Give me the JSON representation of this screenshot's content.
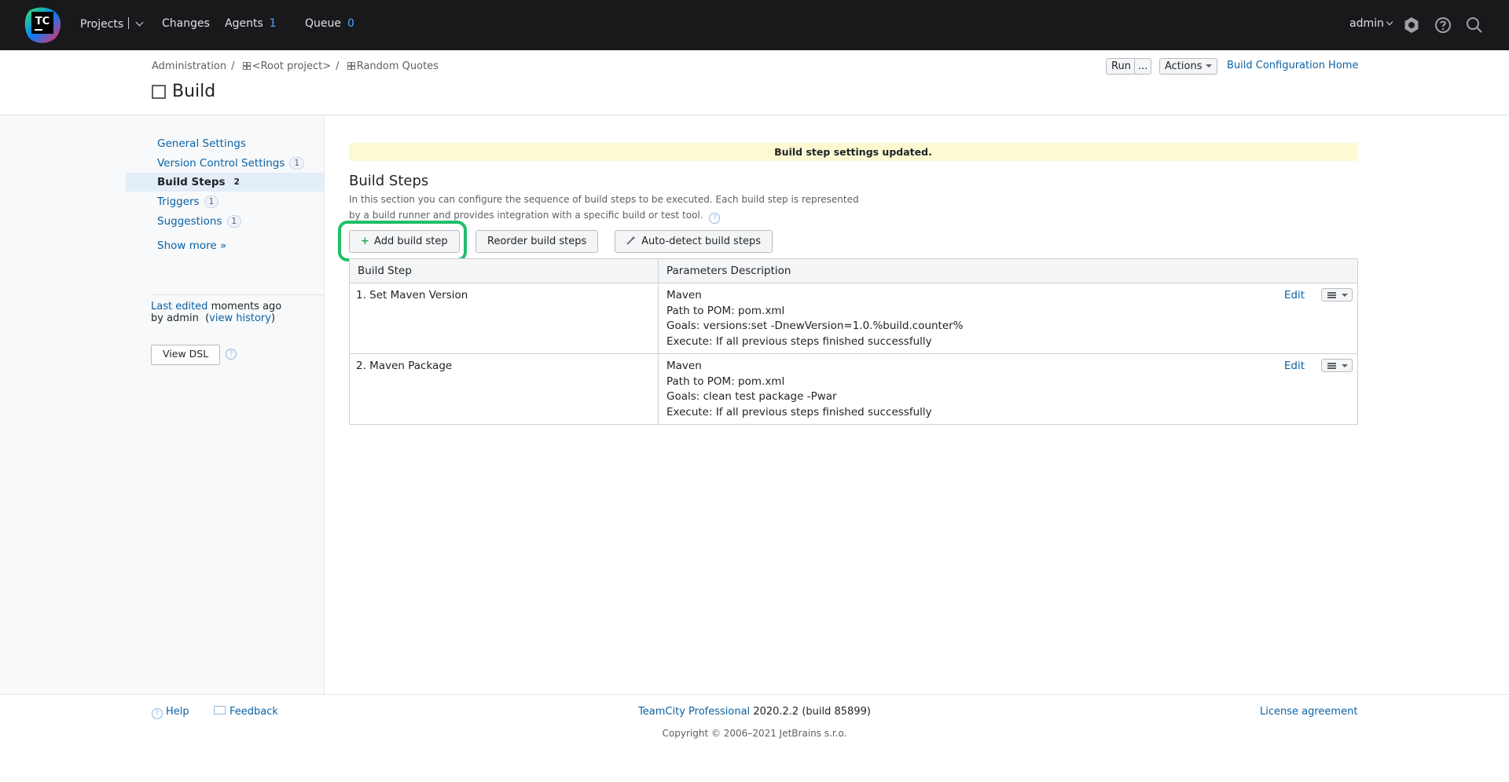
{
  "topbar": {
    "logo_text": "TC",
    "projects_label": "Projects",
    "changes_label": "Changes",
    "agents_label": "Agents",
    "agents_count": "1",
    "queue_label": "Queue",
    "queue_count": "0",
    "user_label": "admin",
    "icons": [
      "logo-icon",
      "settings-icon",
      "help-icon",
      "search-icon"
    ]
  },
  "breadcrumb": {
    "items": [
      "Administration",
      "<Root project>",
      "Random Quotes"
    ],
    "separator": "/"
  },
  "page": {
    "title": "Build",
    "run_label": "Run",
    "run_more_label": "...",
    "actions_label": "Actions",
    "home_link": "Build Configuration Home"
  },
  "sidebar": {
    "items": [
      {
        "label": "General Settings",
        "count": ""
      },
      {
        "label": "Version Control Settings",
        "count": "1"
      },
      {
        "label": "Build Steps",
        "count": "2",
        "active": true
      },
      {
        "label": "Triggers",
        "count": "1"
      },
      {
        "label": "Suggestions",
        "count": "1"
      }
    ],
    "show_more": "Show more »",
    "last_edited_prefix": "Last edited",
    "last_edited_when": "moments ago",
    "by_label": "by admin",
    "view_history": "view history",
    "view_dsl": "View DSL",
    "help_glyph": "?"
  },
  "main": {
    "notice": "Build step settings updated.",
    "section_title": "Build Steps",
    "section_desc": "In this section you can configure the sequence of build steps to be executed. Each build step is represented by a build runner and provides integration with a specific build or test tool.",
    "add_step_icon": "+",
    "add_step": "Add build step",
    "reorder_steps": "Reorder build steps",
    "autodetect_steps": "Auto-detect build steps",
    "table": {
      "headers": [
        "Build Step",
        "Parameters Description"
      ],
      "rows": [
        {
          "name": "1. Set Maven Version",
          "runner": "Maven",
          "pom": "Path to POM: pom.xml",
          "goals": "Goals: versions:set -DnewVersion=1.0.%build.counter%",
          "execute": "Execute: If all previous steps finished successfully",
          "edit": "Edit"
        },
        {
          "name": "2. Maven Package",
          "runner": "Maven",
          "pom": "Path to POM: pom.xml",
          "goals": "Goals: clean test package -Pwar",
          "execute": "Execute: If all previous steps finished successfully",
          "edit": "Edit"
        }
      ]
    }
  },
  "footer": {
    "help": "Help",
    "feedback": "Feedback",
    "product_link": "TeamCity Professional",
    "version": "2020.2.2 (build 85899)",
    "license": "License agreement",
    "copyright": "Copyright © 2006–2021 JetBrains s.r.o."
  },
  "colors": {
    "topbar_bg": "#19191c",
    "link": "#0b61a4",
    "count_blue": "#4fa6ff",
    "notice_bg": "#fdfad3",
    "highlight": "#1fbf6a",
    "sidebar_bg": "#f7f9fa"
  }
}
